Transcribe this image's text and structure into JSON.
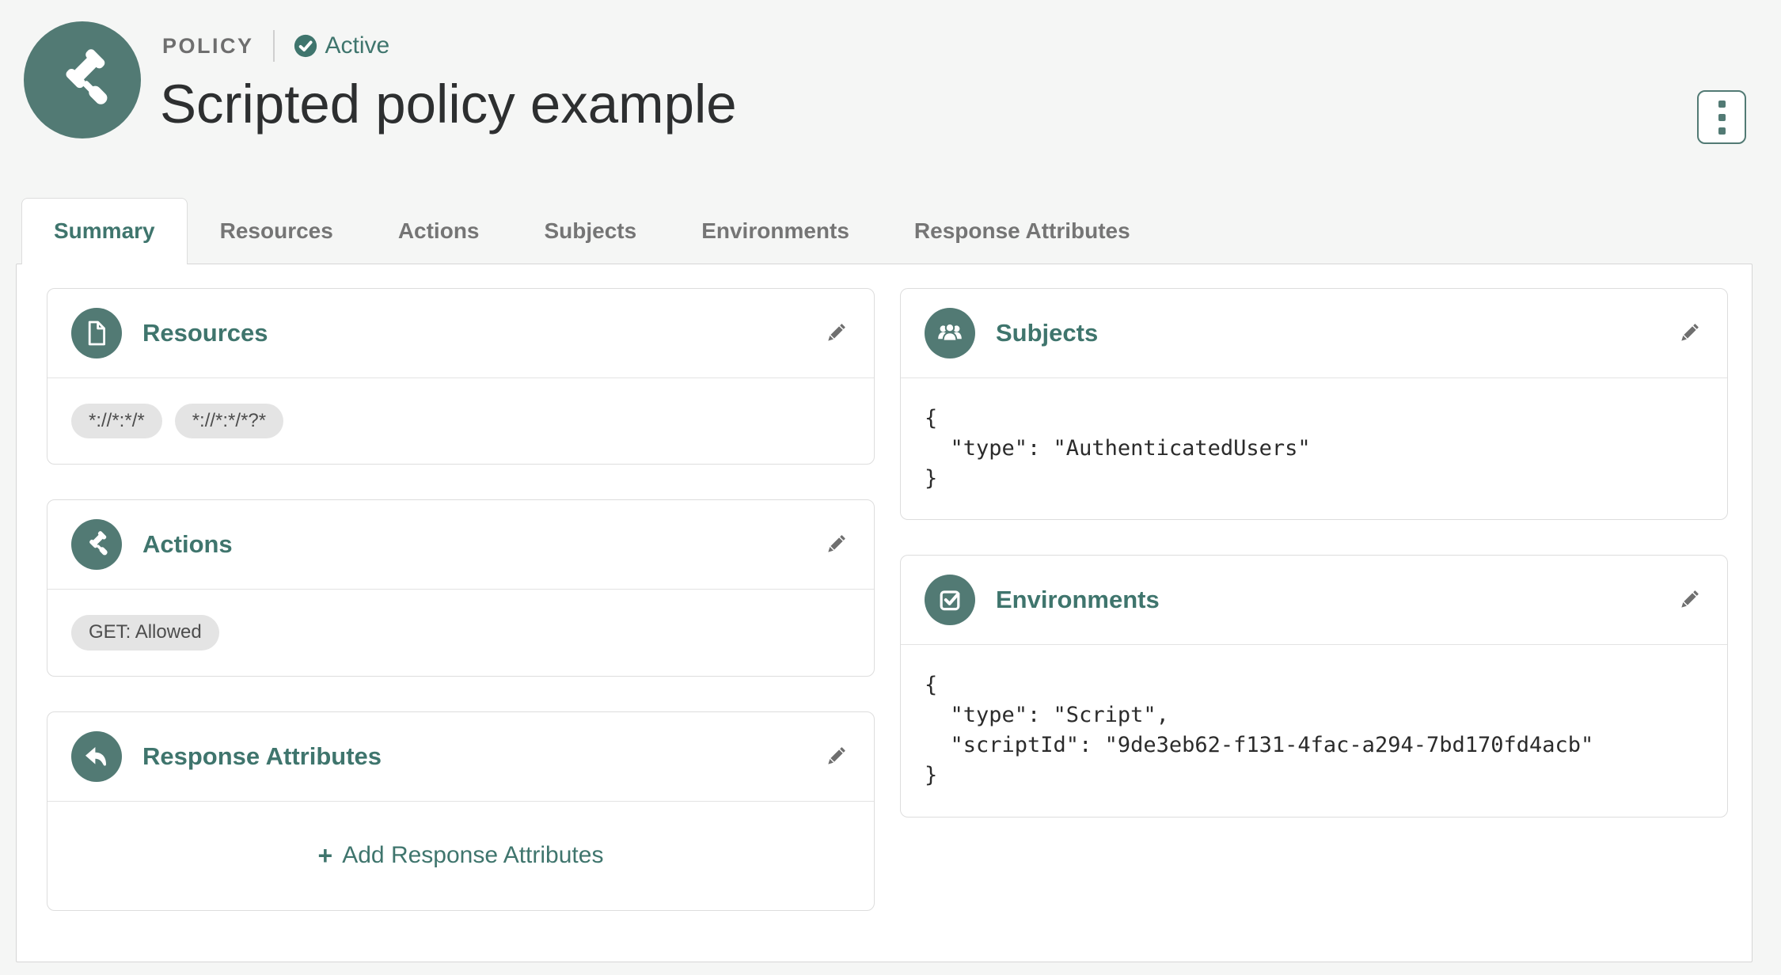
{
  "colors": {
    "accent": "#527a74",
    "accent-text": "#3f756d",
    "page-bg": "#f5f6f5"
  },
  "header": {
    "type_label": "POLICY",
    "status": "Active",
    "title": "Scripted policy example"
  },
  "tabs": {
    "items": [
      {
        "label": "Summary",
        "active": true
      },
      {
        "label": "Resources",
        "active": false
      },
      {
        "label": "Actions",
        "active": false
      },
      {
        "label": "Subjects",
        "active": false
      },
      {
        "label": "Environments",
        "active": false
      },
      {
        "label": "Response Attributes",
        "active": false
      }
    ]
  },
  "cards": {
    "resources": {
      "title": "Resources",
      "tags": [
        "*://*:*/*",
        "*://*:*/*?*"
      ]
    },
    "actions": {
      "title": "Actions",
      "tags": [
        "GET: Allowed"
      ]
    },
    "response_attributes": {
      "title": "Response Attributes",
      "add_plus": "+",
      "add_label": "Add Response Attributes"
    },
    "subjects": {
      "title": "Subjects",
      "json": "{\n  \"type\": \"AuthenticatedUsers\"\n}"
    },
    "environments": {
      "title": "Environments",
      "json": "{\n  \"type\": \"Script\",\n  \"scriptId\": \"9de3eb62-f131-4fac-a294-7bd170fd4acb\"\n}"
    }
  }
}
